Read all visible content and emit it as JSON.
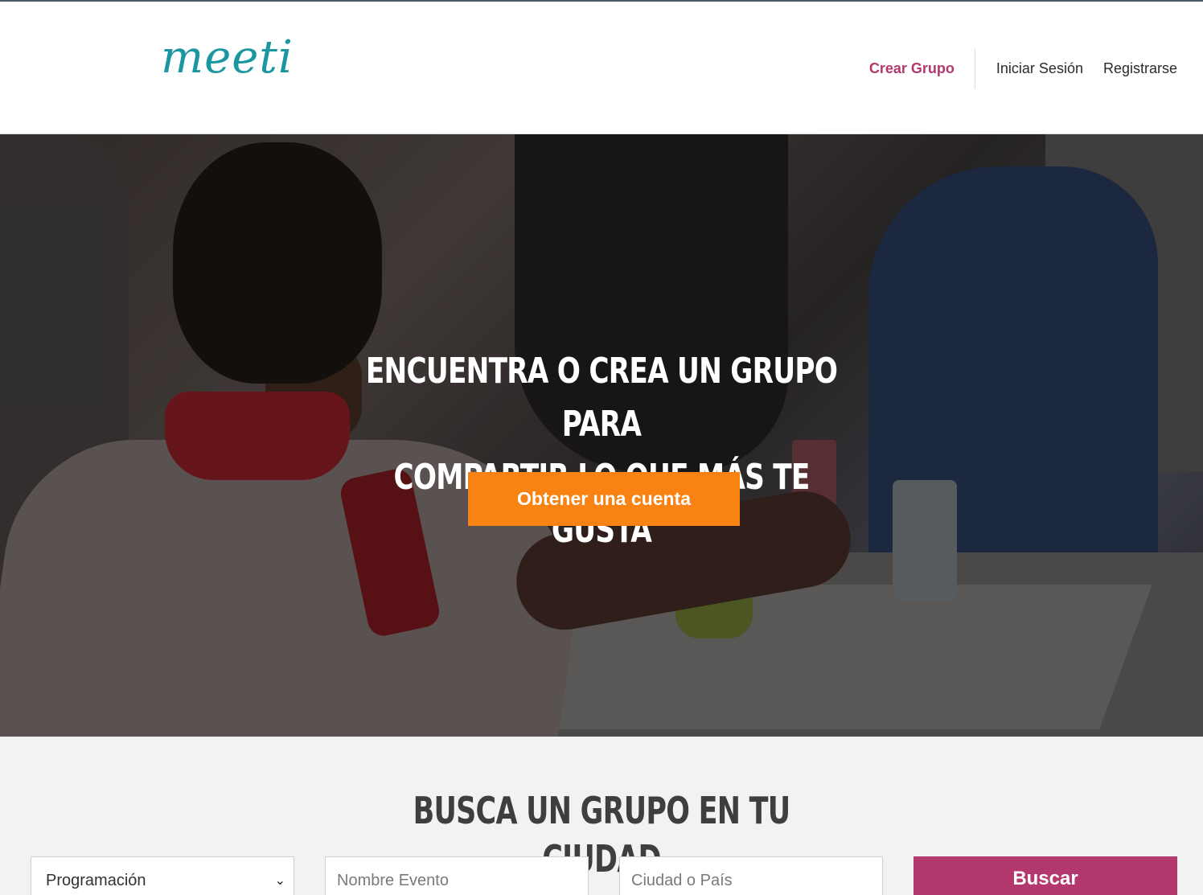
{
  "header": {
    "logo_text": "meeti",
    "nav": {
      "create_group": "Crear Grupo",
      "login": "Iniciar Sesión",
      "register": "Registrarse"
    }
  },
  "hero": {
    "title_line1": "Encuentra o crea un grupo para",
    "title_line2": "compartir lo que más te gusta",
    "cta_label": "Obtener una cuenta"
  },
  "search": {
    "title": "Busca un grupo en tu ciudad",
    "category_selected": "Programación",
    "event_placeholder": "Nombre Evento",
    "city_placeholder": "Ciudad o País",
    "button_label": "Buscar"
  },
  "colors": {
    "brand_teal": "#1a97a0",
    "accent_pink": "#b2386e",
    "cta_orange": "#f88212"
  }
}
